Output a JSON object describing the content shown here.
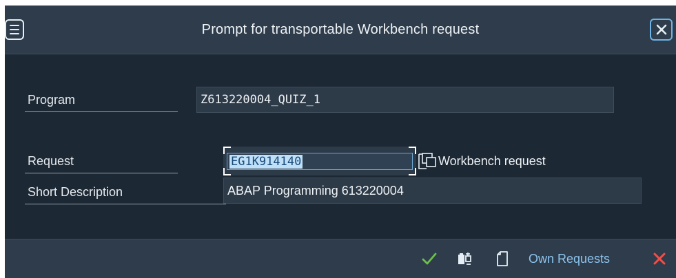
{
  "dialog": {
    "title": "Prompt for transportable Workbench request"
  },
  "icons": {
    "menu": "hamburger-menu-icon",
    "close": "close-icon",
    "value_help": "value-help-icon",
    "continue": "checkmark-icon",
    "create_request": "create-request-icon",
    "new_document": "document-icon",
    "cancel": "cancel-x-icon"
  },
  "form": {
    "program_label": "Program",
    "program_value": "Z613220004_QUIZ_1",
    "request_label": "Request",
    "request_value": "EG1K914140",
    "request_type": "Workbench request",
    "short_description_label": "Short Description",
    "short_description_value": "ABAP Programming 613220004"
  },
  "footer": {
    "own_requests_label": "Own Requests"
  },
  "colors": {
    "background": "#1c2834",
    "bar": "#2e3c4b",
    "accent": "#8cc4ee",
    "check": "#6cc04a",
    "cancel": "#f0504a"
  }
}
